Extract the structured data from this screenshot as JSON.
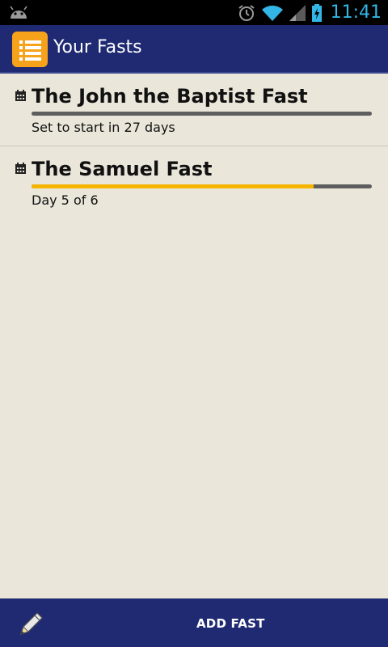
{
  "status_bar": {
    "time": "11:41",
    "icons": [
      "android-icon",
      "alarm-icon",
      "wifi-icon",
      "signal-icon",
      "battery-charging-icon"
    ],
    "accent": "#33B5E5"
  },
  "action_bar": {
    "title": "Your Fasts",
    "icon": "list-icon",
    "background": "#1F2A72",
    "icon_color": "#F7A21B"
  },
  "fasts": [
    {
      "title": "The John the Baptist Fast",
      "status": "Set to start in 27 days",
      "progress": 0,
      "icon": "calendar-icon"
    },
    {
      "title": "The Samuel Fast",
      "status": "Day 5 of 6",
      "progress": 0.83,
      "icon": "calendar-icon"
    }
  ],
  "bottom_bar": {
    "add_label": "ADD FAST",
    "icon": "pencil-icon"
  },
  "colors": {
    "background": "#EAE6DA",
    "progress_fill": "#F5B400",
    "progress_track": "#5E5E5E"
  }
}
